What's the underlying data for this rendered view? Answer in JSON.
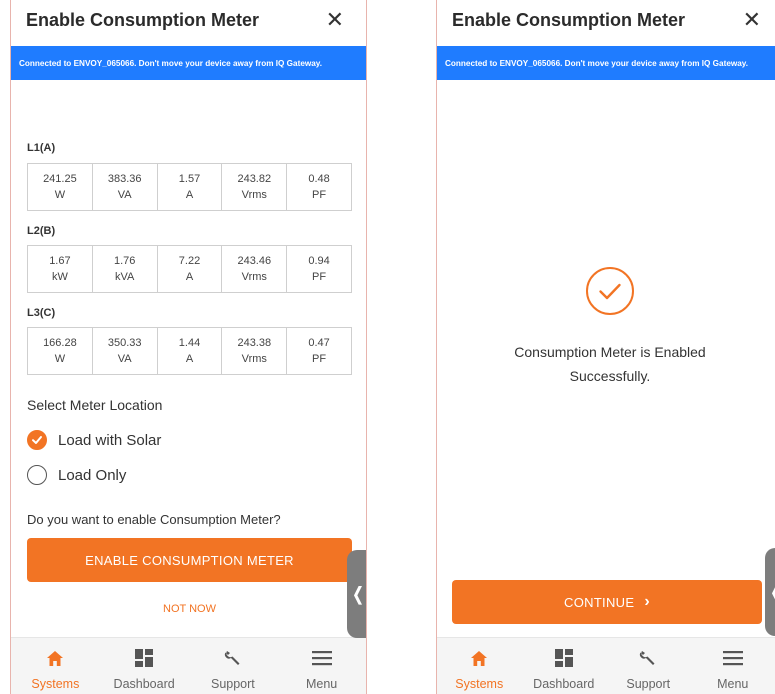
{
  "left_screen": {
    "title": "Enable Consumption Meter",
    "close_icon": "close-icon",
    "banner": "Connected to ENVOY_065066. Don't move your device away from IQ Gateway.",
    "phases": [
      {
        "label": "L1(A)",
        "cells": [
          {
            "value": "241.25",
            "unit": "W"
          },
          {
            "value": "383.36",
            "unit": "VA"
          },
          {
            "value": "1.57",
            "unit": "A"
          },
          {
            "value": "243.82",
            "unit": "Vrms"
          },
          {
            "value": "0.48",
            "unit": "PF"
          }
        ]
      },
      {
        "label": "L2(B)",
        "cells": [
          {
            "value": "1.67",
            "unit": "kW"
          },
          {
            "value": "1.76",
            "unit": "kVA"
          },
          {
            "value": "7.22",
            "unit": "A"
          },
          {
            "value": "243.46",
            "unit": "Vrms"
          },
          {
            "value": "0.94",
            "unit": "PF"
          }
        ]
      },
      {
        "label": "L3(C)",
        "cells": [
          {
            "value": "166.28",
            "unit": "W"
          },
          {
            "value": "350.33",
            "unit": "VA"
          },
          {
            "value": "1.44",
            "unit": "A"
          },
          {
            "value": "243.38",
            "unit": "Vrms"
          },
          {
            "value": "0.47",
            "unit": "PF"
          }
        ]
      }
    ],
    "meter_location": {
      "title": "Select Meter Location",
      "options": [
        {
          "label": "Load with Solar",
          "selected": true
        },
        {
          "label": "Load Only",
          "selected": false
        }
      ]
    },
    "question": "Do you want to enable Consumption Meter?",
    "enable_button": "ENABLE CONSUMPTION METER",
    "not_now": "NOT NOW",
    "handle_glyph": "❬"
  },
  "right_screen": {
    "title": "Enable Consumption Meter",
    "close_icon": "close-icon",
    "banner": "Connected to ENVOY_065066. Don't move your device away from IQ Gateway.",
    "success_icon": "check-circle-icon",
    "success_line1": "Consumption Meter is Enabled",
    "success_line2": "Successfully.",
    "continue_button": "CONTINUE",
    "continue_chevron": "›",
    "handle_glyph": "❬"
  },
  "tab_bar": {
    "tabs": [
      {
        "label": "Systems",
        "icon": "home-icon",
        "active": true
      },
      {
        "label": "Dashboard",
        "icon": "dashboard-icon",
        "active": false
      },
      {
        "label": "Support",
        "icon": "wrench-icon",
        "active": false
      },
      {
        "label": "Menu",
        "icon": "menu-icon",
        "active": false
      }
    ]
  },
  "colors": {
    "accent": "#f27424",
    "banner_blue": "#1f7cff",
    "tab_bar_bg": "#f5f5f5"
  }
}
